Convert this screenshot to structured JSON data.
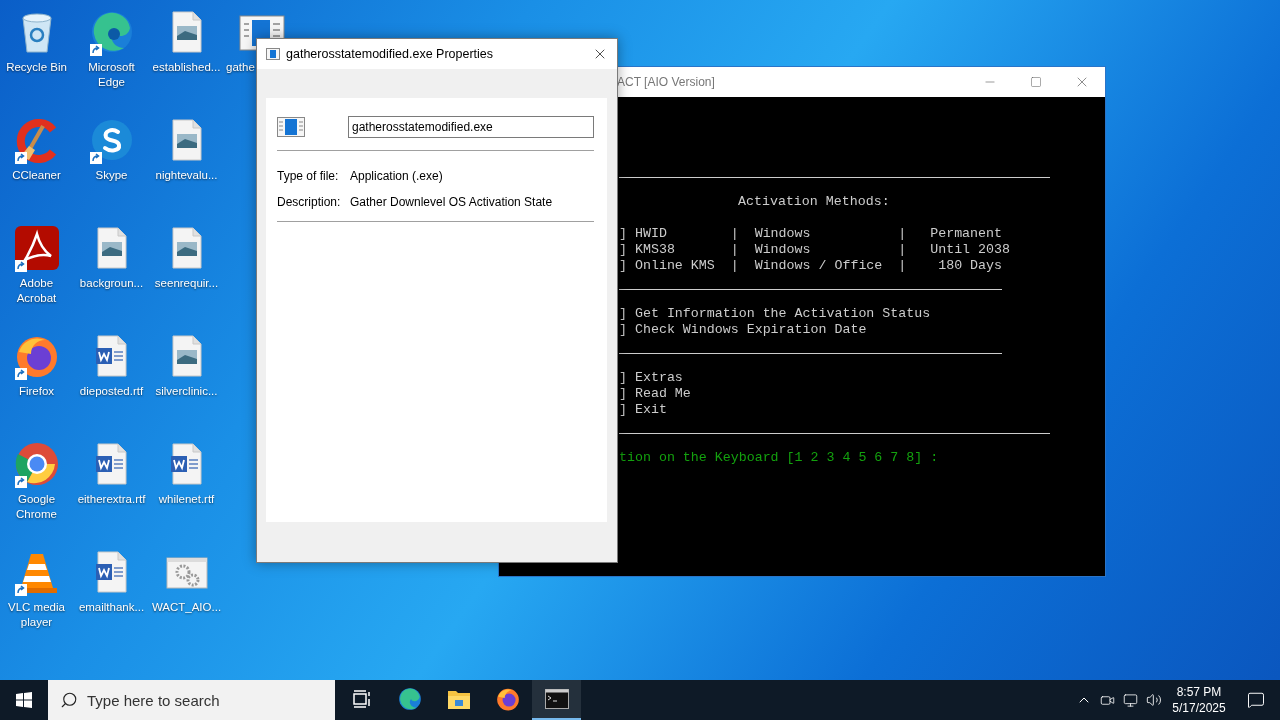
{
  "desktop": {
    "icons": [
      {
        "label": "Recycle Bin",
        "kind": "recycle",
        "shortcut": false,
        "cut": false
      },
      {
        "label": "CCleaner",
        "kind": "ccleaner",
        "shortcut": true,
        "cut": false
      },
      {
        "label": "Adobe Acrobat",
        "kind": "acrobat",
        "shortcut": true,
        "cut": false
      },
      {
        "label": "Firefox",
        "kind": "firefox",
        "shortcut": true,
        "cut": false
      },
      {
        "label": "Google Chrome",
        "kind": "chrome",
        "shortcut": true,
        "cut": false
      },
      {
        "label": "VLC media player",
        "kind": "vlc",
        "shortcut": true,
        "cut": false
      },
      {
        "label": "Microsoft Edge",
        "kind": "edge",
        "shortcut": true,
        "cut": false
      },
      {
        "label": "Skype",
        "kind": "skype",
        "shortcut": true,
        "cut": false
      },
      {
        "label": "backgroun...",
        "kind": "image",
        "shortcut": false,
        "cut": false
      },
      {
        "label": "dieposted.rtf",
        "kind": "word",
        "shortcut": false,
        "cut": false
      },
      {
        "label": "eitherextra.rtf",
        "kind": "word",
        "shortcut": false,
        "cut": false
      },
      {
        "label": "emailthank...",
        "kind": "word",
        "shortcut": false,
        "cut": false
      },
      {
        "label": "established...",
        "kind": "image",
        "shortcut": false,
        "cut": false
      },
      {
        "label": "nightevalu...",
        "kind": "image",
        "shortcut": false,
        "cut": false
      },
      {
        "label": "seenrequir...",
        "kind": "image",
        "shortcut": false,
        "cut": false
      },
      {
        "label": "silverclinic...",
        "kind": "image",
        "shortcut": false,
        "cut": false
      },
      {
        "label": "whilenet.rtf",
        "kind": "word",
        "shortcut": false,
        "cut": false
      },
      {
        "label": "WACT_AIO...",
        "kind": "settings",
        "shortcut": false,
        "cut": false
      },
      {
        "label": "gathe",
        "kind": "app",
        "shortcut": false,
        "cut": true
      }
    ]
  },
  "console_window": {
    "title": "ACT [AIO Version]",
    "lines": [
      {
        "kind": "rule_long"
      },
      {
        "kind": "heading",
        "text": "Activation Methods:"
      },
      {
        "kind": "blank"
      },
      {
        "kind": "text",
        "text": "] HWID        |  Windows           |   Permanent"
      },
      {
        "kind": "text",
        "text": "] KMS38       |  Windows           |   Until 2038"
      },
      {
        "kind": "text",
        "text": "] Online KMS  |  Windows / Office  |    180 Days"
      },
      {
        "kind": "rule_short"
      },
      {
        "kind": "text",
        "text": "] Get Information the Activation Status"
      },
      {
        "kind": "text",
        "text": "] Check Windows Expiration Date"
      },
      {
        "kind": "rule_short"
      },
      {
        "kind": "text",
        "text": "] Extras"
      },
      {
        "kind": "text",
        "text": "] Read Me"
      },
      {
        "kind": "text",
        "text": "] Exit"
      },
      {
        "kind": "rule_long"
      },
      {
        "kind": "prompt",
        "text": "tion on the Keyboard [1 2 3 4 5 6 7 8] :"
      }
    ]
  },
  "properties_dialog": {
    "title": "gatherosstatemodified.exe Properties",
    "file_name": "gatherosstatemodified.exe",
    "fields": [
      {
        "label": "Type of file:",
        "value": "Application (.exe)"
      },
      {
        "label": "Description:",
        "value": "Gather Downlevel OS Activation State"
      }
    ]
  },
  "taskbar": {
    "search": {
      "placeholder": "Type here to search"
    },
    "apps": [
      {
        "kind": "task_view",
        "selected": false
      },
      {
        "kind": "edge",
        "selected": false
      },
      {
        "kind": "explorer",
        "selected": false
      },
      {
        "kind": "firefox",
        "selected": false
      },
      {
        "kind": "console",
        "selected": true
      }
    ],
    "tray": {
      "time": "8:57 PM",
      "date": "5/17/2025"
    }
  }
}
